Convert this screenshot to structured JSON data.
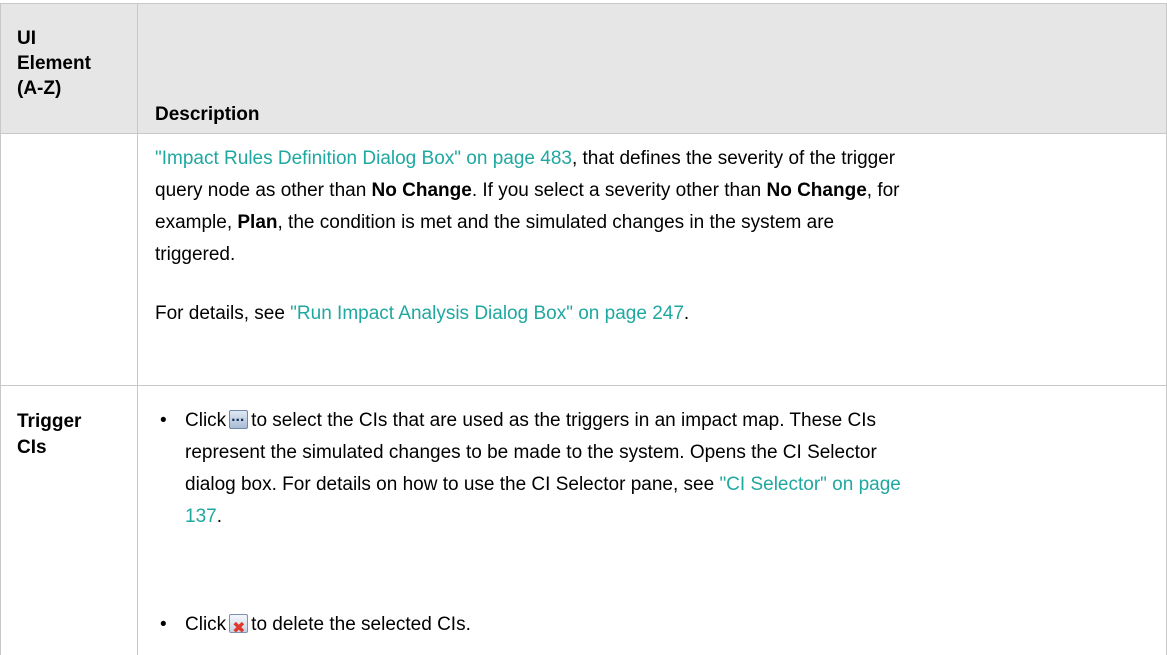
{
  "header": {
    "col1_line1": "UI",
    "col1_line2": "Element",
    "col1_line3": "(A-Z)",
    "col2": "Description"
  },
  "row1": {
    "line1_link": "\"Impact Rules Definition Dialog Box\" on page 483",
    "line1_rest": ", that defines the severity of the trigger",
    "line2_a": "query node as other than ",
    "line2_bold1": "No Change",
    "line2_b": ". If you select a severity other than ",
    "line2_bold2": "No Change",
    "line2_c": ", for",
    "line3_a": "example, ",
    "line3_bold": "Plan",
    "line3_b": ", the condition is met and the simulated changes in the system are",
    "line4": "triggered.",
    "details_prefix": "For details, see ",
    "details_link": "\"Run Impact Analysis Dialog Box\" on page 247",
    "details_suffix": "."
  },
  "row2": {
    "label_line1": "Trigger",
    "label_line2": "CIs",
    "bullet1": {
      "click": "Click",
      "line1_rest": "to select the CIs that are used as the triggers in an impact map. These CIs",
      "line2": "represent the simulated changes to be made to the system. Opens the CI Selector",
      "line3_a": "dialog box. For details on how to use the CI Selector pane, see ",
      "line3_link": "\"CI Selector\" on page",
      "line4_link": "137",
      "line4_suffix": "."
    },
    "bullet2": {
      "click": "Click",
      "rest": "to delete the selected CIs."
    },
    "icons": [
      "browse-icon",
      "delete-icon"
    ]
  },
  "colors": {
    "link": "#1fa8a0",
    "header_bg": "#e6e6e6",
    "border": "#c8c8c8"
  }
}
